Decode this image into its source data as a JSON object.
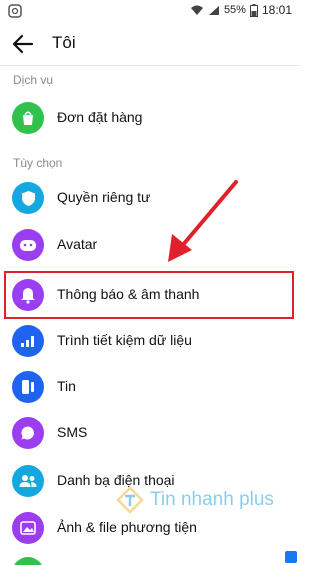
{
  "statusbar": {
    "battery": "55%",
    "time": "18:01"
  },
  "header": {
    "title": "Tôi"
  },
  "sections": {
    "services": "Dịch vụ",
    "options": "Tùy chọn"
  },
  "items": {
    "orders": "Đơn đặt hàng",
    "privacy": "Quyền riêng tư",
    "avatar": "Avatar",
    "notifications": "Thông báo & âm thanh",
    "data_saver": "Trình tiết kiệm dữ liệu",
    "stories": "Tin",
    "sms": "SMS",
    "contacts": "Danh bạ điện thoại",
    "photos_media": "Ảnh & file phương tiện"
  },
  "watermark": "Tin nhanh plus",
  "colors": {
    "green": "#31c24d",
    "cyan": "#13a8e0",
    "purple": "#9b3ef2",
    "blue": "#1e64f0",
    "highlight": "#e0202b"
  },
  "icons": {
    "orders": "shopping-bag-icon",
    "privacy": "shield-icon",
    "avatar": "avatar-face-icon",
    "notifications": "bell-icon",
    "data_saver": "signal-icon",
    "stories": "stories-icon",
    "sms": "chat-bubble-icon",
    "contacts": "people-icon",
    "photos_media": "image-icon"
  }
}
